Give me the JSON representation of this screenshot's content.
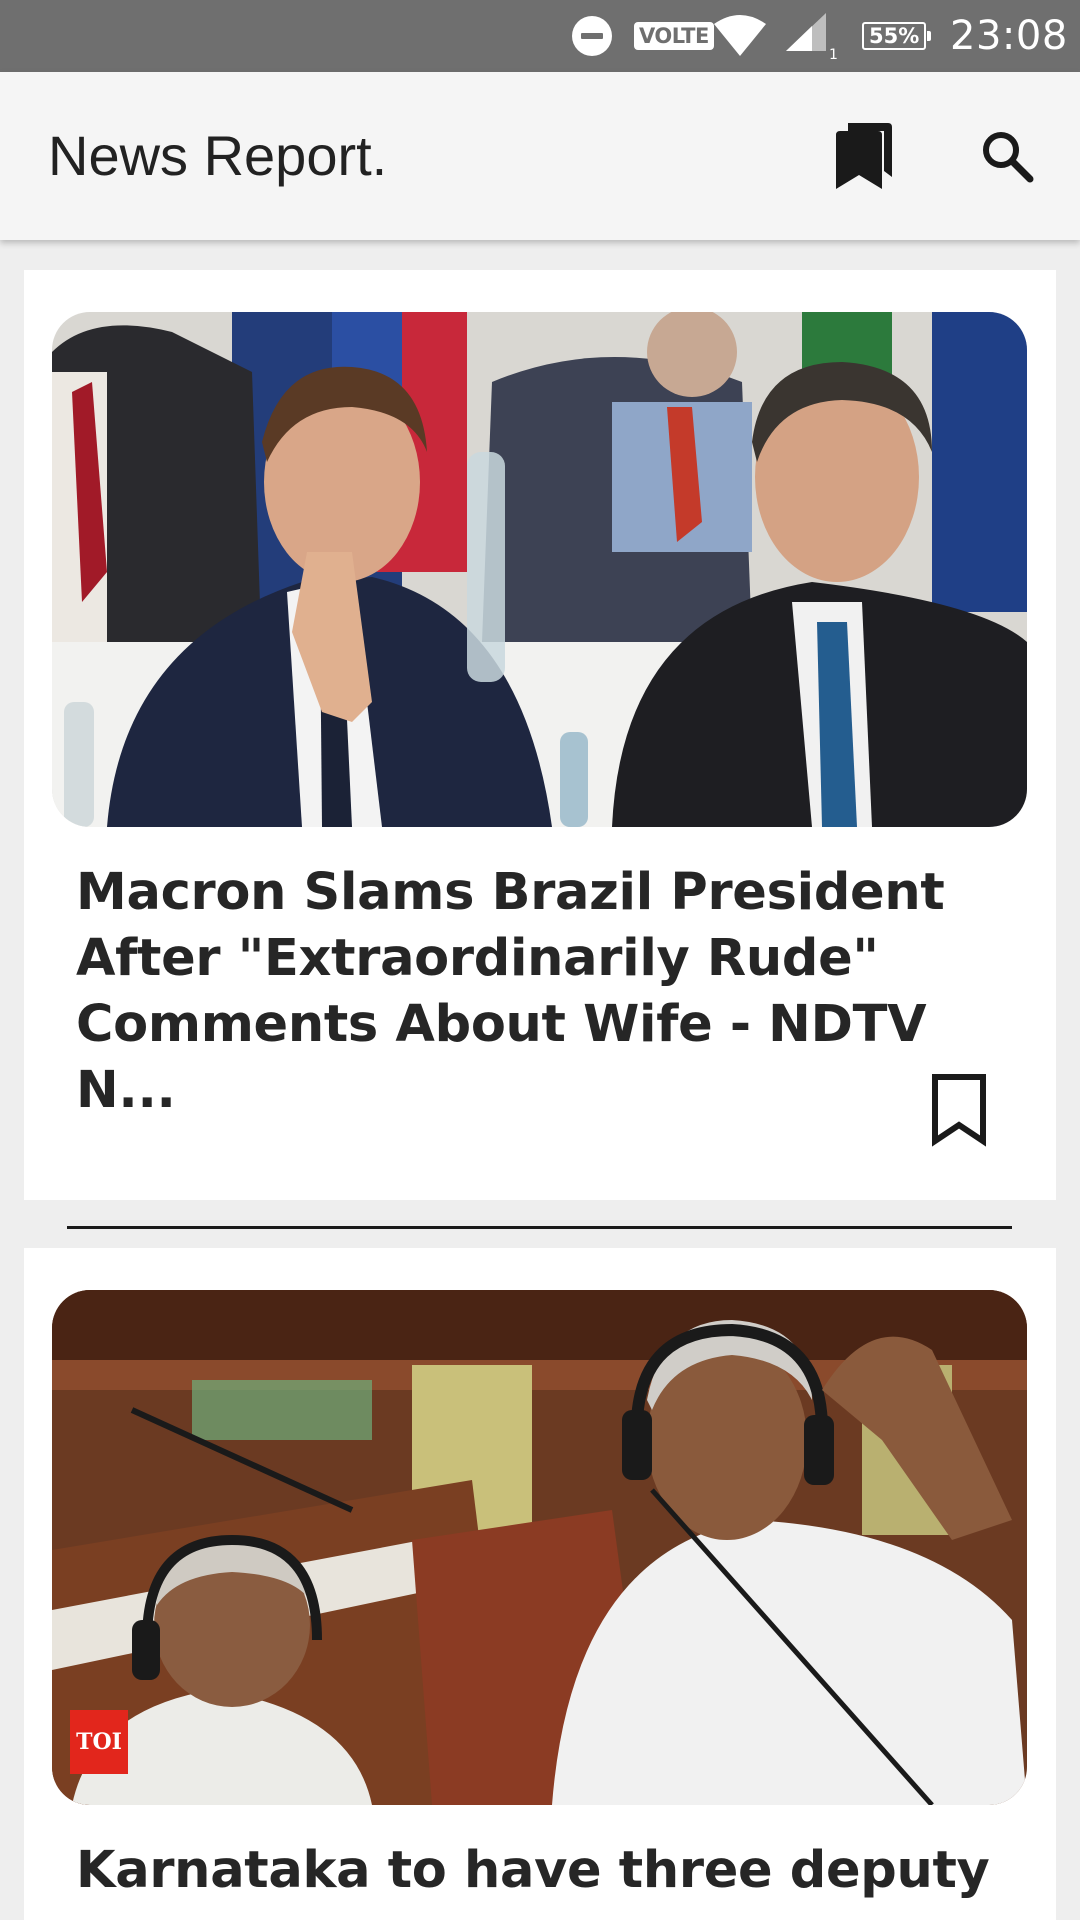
{
  "status_bar": {
    "time": "23:08",
    "network_label": "VOLTE",
    "signal_sub": "1",
    "battery": "55%",
    "icons": [
      "do-not-disturb-icon",
      "volte-icon",
      "wifi-icon",
      "signal-icon",
      "battery-icon"
    ]
  },
  "app_bar": {
    "title": "News Report.",
    "actions": [
      {
        "name": "bookmarks",
        "icon": "bookmarks-icon"
      },
      {
        "name": "search",
        "icon": "search-icon"
      }
    ]
  },
  "articles": [
    {
      "headline": "Macron Slams Brazil President After \"Extraordinarily Rude\" Comments About Wife - NDTV N...",
      "image_description": "photo-two-leaders-at-summit",
      "bookmark_icon": "bookmark-outline-icon"
    },
    {
      "headline": "Karnataka to have three deputy",
      "image_description": "photo-legislators-with-headphones",
      "source_badge": "TOI"
    }
  ],
  "colors": {
    "status_bar": "#6f6f6f",
    "app_bar": "#f5f5f5",
    "background": "#eeeeee",
    "card": "#ffffff",
    "headline": "#262626",
    "toi_red": "#e2261c"
  }
}
